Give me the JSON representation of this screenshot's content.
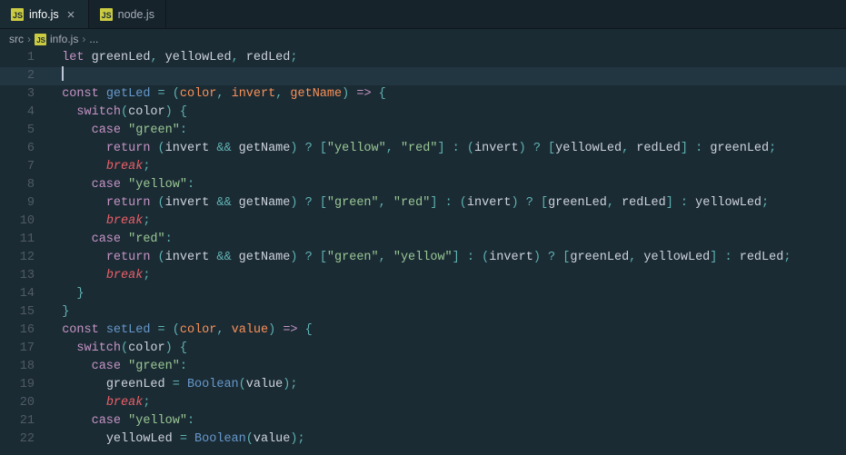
{
  "tabs": [
    {
      "label": "info.js",
      "active": true
    },
    {
      "label": "node.js",
      "active": false
    }
  ],
  "breadcrumb": {
    "folder": "src",
    "file": "info.js",
    "more": "..."
  },
  "code": {
    "lines": [
      {
        "n": 1,
        "tokens": [
          [
            "kw",
            "let"
          ],
          [
            "id",
            " greenLed"
          ],
          [
            "op",
            ", "
          ],
          [
            "id",
            "yellowLed"
          ],
          [
            "op",
            ", "
          ],
          [
            "id",
            "redLed"
          ],
          [
            "op",
            ";"
          ]
        ]
      },
      {
        "n": 2,
        "cursor": true,
        "tokens": []
      },
      {
        "n": 3,
        "tokens": [
          [
            "kw",
            "const"
          ],
          [
            "id",
            " "
          ],
          [
            "fn",
            "getLed"
          ],
          [
            "id",
            " "
          ],
          [
            "op",
            "="
          ],
          [
            "id",
            " "
          ],
          [
            "op",
            "("
          ],
          [
            "pn",
            "color"
          ],
          [
            "op",
            ", "
          ],
          [
            "pn",
            "invert"
          ],
          [
            "op",
            ", "
          ],
          [
            "pn",
            "getName"
          ],
          [
            "op",
            ")"
          ],
          [
            "id",
            " "
          ],
          [
            "kw",
            "=>"
          ],
          [
            "id",
            " "
          ],
          [
            "op",
            "{"
          ]
        ]
      },
      {
        "n": 4,
        "indent": 2,
        "tokens": [
          [
            "kw",
            "switch"
          ],
          [
            "op",
            "("
          ],
          [
            "id",
            "color"
          ],
          [
            "op",
            ")"
          ],
          [
            "id",
            " "
          ],
          [
            "op",
            "{"
          ]
        ]
      },
      {
        "n": 5,
        "indent": 4,
        "tokens": [
          [
            "kw",
            "case"
          ],
          [
            "id",
            " "
          ],
          [
            "str",
            "\"green\""
          ],
          [
            "op",
            ":"
          ]
        ]
      },
      {
        "n": 6,
        "indent": 6,
        "tokens": [
          [
            "kw",
            "return"
          ],
          [
            "id",
            " "
          ],
          [
            "op",
            "("
          ],
          [
            "id",
            "invert "
          ],
          [
            "op",
            "&&"
          ],
          [
            "id",
            " getName"
          ],
          [
            "op",
            ")"
          ],
          [
            "id",
            " "
          ],
          [
            "op",
            "?"
          ],
          [
            "id",
            " "
          ],
          [
            "op",
            "["
          ],
          [
            "str",
            "\"yellow\""
          ],
          [
            "op",
            ", "
          ],
          [
            "str",
            "\"red\""
          ],
          [
            "op",
            "]"
          ],
          [
            "id",
            " "
          ],
          [
            "op",
            ":"
          ],
          [
            "id",
            " "
          ],
          [
            "op",
            "("
          ],
          [
            "id",
            "invert"
          ],
          [
            "op",
            ")"
          ],
          [
            "id",
            " "
          ],
          [
            "op",
            "?"
          ],
          [
            "id",
            " "
          ],
          [
            "op",
            "["
          ],
          [
            "id",
            "yellowLed"
          ],
          [
            "op",
            ", "
          ],
          [
            "id",
            "redLed"
          ],
          [
            "op",
            "]"
          ],
          [
            "id",
            " "
          ],
          [
            "op",
            ":"
          ],
          [
            "id",
            " greenLed"
          ],
          [
            "op",
            ";"
          ]
        ]
      },
      {
        "n": 7,
        "indent": 6,
        "tokens": [
          [
            "ctrl",
            "break"
          ],
          [
            "op",
            ";"
          ]
        ]
      },
      {
        "n": 8,
        "indent": 4,
        "tokens": [
          [
            "kw",
            "case"
          ],
          [
            "id",
            " "
          ],
          [
            "str",
            "\"yellow\""
          ],
          [
            "op",
            ":"
          ]
        ]
      },
      {
        "n": 9,
        "indent": 6,
        "tokens": [
          [
            "kw",
            "return"
          ],
          [
            "id",
            " "
          ],
          [
            "op",
            "("
          ],
          [
            "id",
            "invert "
          ],
          [
            "op",
            "&&"
          ],
          [
            "id",
            " getName"
          ],
          [
            "op",
            ")"
          ],
          [
            "id",
            " "
          ],
          [
            "op",
            "?"
          ],
          [
            "id",
            " "
          ],
          [
            "op",
            "["
          ],
          [
            "str",
            "\"green\""
          ],
          [
            "op",
            ", "
          ],
          [
            "str",
            "\"red\""
          ],
          [
            "op",
            "]"
          ],
          [
            "id",
            " "
          ],
          [
            "op",
            ":"
          ],
          [
            "id",
            " "
          ],
          [
            "op",
            "("
          ],
          [
            "id",
            "invert"
          ],
          [
            "op",
            ")"
          ],
          [
            "id",
            " "
          ],
          [
            "op",
            "?"
          ],
          [
            "id",
            " "
          ],
          [
            "op",
            "["
          ],
          [
            "id",
            "greenLed"
          ],
          [
            "op",
            ", "
          ],
          [
            "id",
            "redLed"
          ],
          [
            "op",
            "]"
          ],
          [
            "id",
            " "
          ],
          [
            "op",
            ":"
          ],
          [
            "id",
            " yellowLed"
          ],
          [
            "op",
            ";"
          ]
        ]
      },
      {
        "n": 10,
        "indent": 6,
        "tokens": [
          [
            "ctrl",
            "break"
          ],
          [
            "op",
            ";"
          ]
        ]
      },
      {
        "n": 11,
        "indent": 4,
        "tokens": [
          [
            "kw",
            "case"
          ],
          [
            "id",
            " "
          ],
          [
            "str",
            "\"red\""
          ],
          [
            "op",
            ":"
          ]
        ]
      },
      {
        "n": 12,
        "indent": 6,
        "tokens": [
          [
            "kw",
            "return"
          ],
          [
            "id",
            " "
          ],
          [
            "op",
            "("
          ],
          [
            "id",
            "invert "
          ],
          [
            "op",
            "&&"
          ],
          [
            "id",
            " getName"
          ],
          [
            "op",
            ")"
          ],
          [
            "id",
            " "
          ],
          [
            "op",
            "?"
          ],
          [
            "id",
            " "
          ],
          [
            "op",
            "["
          ],
          [
            "str",
            "\"green\""
          ],
          [
            "op",
            ", "
          ],
          [
            "str",
            "\"yellow\""
          ],
          [
            "op",
            "]"
          ],
          [
            "id",
            " "
          ],
          [
            "op",
            ":"
          ],
          [
            "id",
            " "
          ],
          [
            "op",
            "("
          ],
          [
            "id",
            "invert"
          ],
          [
            "op",
            ")"
          ],
          [
            "id",
            " "
          ],
          [
            "op",
            "?"
          ],
          [
            "id",
            " "
          ],
          [
            "op",
            "["
          ],
          [
            "id",
            "greenLed"
          ],
          [
            "op",
            ", "
          ],
          [
            "id",
            "yellowLed"
          ],
          [
            "op",
            "]"
          ],
          [
            "id",
            " "
          ],
          [
            "op",
            ":"
          ],
          [
            "id",
            " redLed"
          ],
          [
            "op",
            ";"
          ]
        ]
      },
      {
        "n": 13,
        "indent": 6,
        "tokens": [
          [
            "ctrl",
            "break"
          ],
          [
            "op",
            ";"
          ]
        ]
      },
      {
        "n": 14,
        "indent": 2,
        "tokens": [
          [
            "op",
            "}"
          ]
        ]
      },
      {
        "n": 15,
        "tokens": [
          [
            "op",
            "}"
          ]
        ]
      },
      {
        "n": 16,
        "tokens": [
          [
            "kw",
            "const"
          ],
          [
            "id",
            " "
          ],
          [
            "fn",
            "setLed"
          ],
          [
            "id",
            " "
          ],
          [
            "op",
            "="
          ],
          [
            "id",
            " "
          ],
          [
            "op",
            "("
          ],
          [
            "pn",
            "color"
          ],
          [
            "op",
            ", "
          ],
          [
            "pn",
            "value"
          ],
          [
            "op",
            ")"
          ],
          [
            "id",
            " "
          ],
          [
            "kw",
            "=>"
          ],
          [
            "id",
            " "
          ],
          [
            "op",
            "{"
          ]
        ]
      },
      {
        "n": 17,
        "indent": 2,
        "tokens": [
          [
            "kw",
            "switch"
          ],
          [
            "op",
            "("
          ],
          [
            "id",
            "color"
          ],
          [
            "op",
            ")"
          ],
          [
            "id",
            " "
          ],
          [
            "op",
            "{"
          ]
        ]
      },
      {
        "n": 18,
        "indent": 4,
        "tokens": [
          [
            "kw",
            "case"
          ],
          [
            "id",
            " "
          ],
          [
            "str",
            "\"green\""
          ],
          [
            "op",
            ":"
          ]
        ]
      },
      {
        "n": 19,
        "indent": 6,
        "tokens": [
          [
            "id",
            "greenLed "
          ],
          [
            "op",
            "="
          ],
          [
            "id",
            " "
          ],
          [
            "fn",
            "Boolean"
          ],
          [
            "op",
            "("
          ],
          [
            "id",
            "value"
          ],
          [
            "op",
            ");"
          ]
        ]
      },
      {
        "n": 20,
        "indent": 6,
        "tokens": [
          [
            "ctrl",
            "break"
          ],
          [
            "op",
            ";"
          ]
        ]
      },
      {
        "n": 21,
        "indent": 4,
        "tokens": [
          [
            "kw",
            "case"
          ],
          [
            "id",
            " "
          ],
          [
            "str",
            "\"yellow\""
          ],
          [
            "op",
            ":"
          ]
        ]
      },
      {
        "n": 22,
        "indent": 6,
        "tokens": [
          [
            "id",
            "yellowLed "
          ],
          [
            "op",
            "="
          ],
          [
            "id",
            " "
          ],
          [
            "fn",
            "Boolean"
          ],
          [
            "op",
            "("
          ],
          [
            "id",
            "value"
          ],
          [
            "op",
            ");"
          ]
        ]
      }
    ]
  }
}
